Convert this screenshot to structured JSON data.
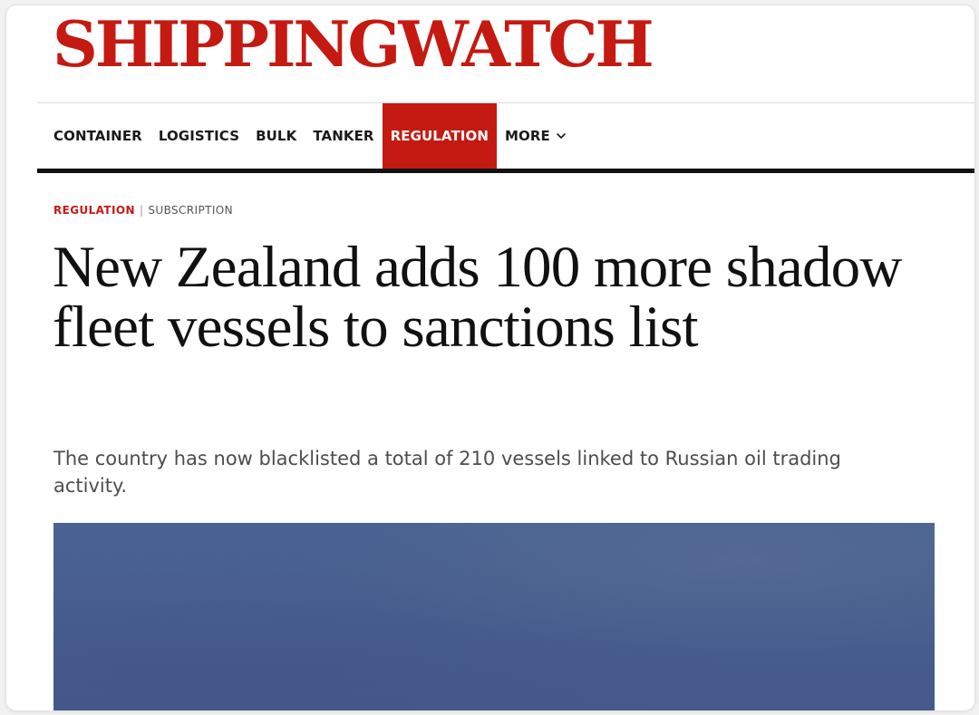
{
  "brand": {
    "name": "SHIPPINGWATCH",
    "color": "#c41a12"
  },
  "nav": {
    "items": [
      {
        "label": "CONTAINER"
      },
      {
        "label": "LOGISTICS"
      },
      {
        "label": "BULK"
      },
      {
        "label": "TANKER"
      },
      {
        "label": "REGULATION",
        "active": true
      },
      {
        "label": "MORE",
        "icon": "chevron-down-icon"
      }
    ]
  },
  "article": {
    "section": "REGULATION",
    "separator": "|",
    "access": "SUBSCRIPTION",
    "headline": "New Zealand adds 100 more shadow fleet vessels to sanctions list",
    "lead": "The country has now blacklisted a total of 210 vessels linked to Russian oil trading activity."
  },
  "colors": {
    "accent": "#c41a12",
    "text": "#111111",
    "muted": "#4d4d4d",
    "hero": "#46598a"
  }
}
